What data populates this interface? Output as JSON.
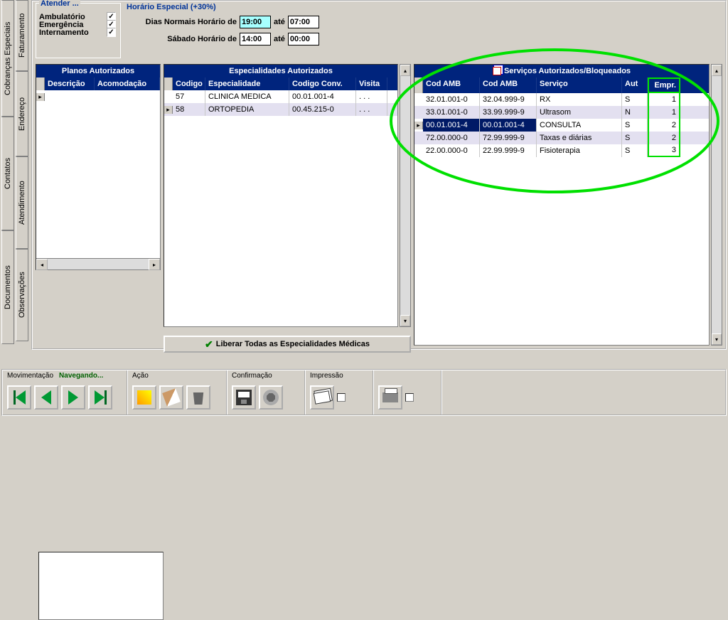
{
  "vtabs": {
    "col1": [
      "Cobranças Especiais",
      "Contatos",
      "Documentos"
    ],
    "col2": [
      "Faturamento",
      "Endereço",
      "Atendimento",
      "Observações"
    ]
  },
  "atender": {
    "title": "Atender ...",
    "items": [
      "Ambulatório",
      "Emergência",
      "Internamento"
    ]
  },
  "horario": {
    "title": "Horário Especial  (+30%)",
    "row1_label": "Dias Normais Horário de",
    "row1_from": "19:00",
    "ate": "até",
    "row1_to": "07:00",
    "row2_label": "Sábado Horário de",
    "row2_from": "14:00",
    "row2_to": "00:00"
  },
  "planos": {
    "title": "Planos Autorizados",
    "headers": [
      "Descrição",
      "Acomodação"
    ]
  },
  "esp": {
    "title": "Especialidades Autorizados",
    "headers": [
      "Codigo",
      "Especialidade",
      "Codigo Conv.",
      "Visita"
    ],
    "rows": [
      {
        "codigo": "57",
        "esp": "CLINICA MEDICA",
        "conv": "00.01.001-4",
        "vis": ". . ."
      },
      {
        "codigo": "58",
        "esp": "ORTOPEDIA",
        "conv": "00.45.215-0",
        "vis": ". . ."
      }
    ],
    "liberar": "Liberar Todas as Especialidades Médicas"
  },
  "serv": {
    "title": "Serviços Autorizados/Bloqueados",
    "headers": [
      "Cod AMB",
      "Cod AMB",
      "Serviço",
      "Aut",
      "Empr."
    ],
    "rows": [
      {
        "c1": "32.01.001-0",
        "c2": "32.04.999-9",
        "svc": "RX",
        "aut": "S",
        "emp": "1"
      },
      {
        "c1": "33.01.001-0",
        "c2": "33.99.999-9",
        "svc": "Ultrasom",
        "aut": "N",
        "emp": "1"
      },
      {
        "c1": "00.01.001-4",
        "c2": "00.01.001-4",
        "svc": "CONSULTA",
        "aut": "S",
        "emp": "2",
        "sel": true
      },
      {
        "c1": "72.00.000-0",
        "c2": "72.99.999-9",
        "svc": "Taxas e diárias",
        "aut": "S",
        "emp": "2"
      },
      {
        "c1": "22.00.000-0",
        "c2": "22.99.999-9",
        "svc": "Fisioterapia",
        "aut": "S",
        "emp": "3"
      }
    ]
  },
  "bottom": {
    "mov": "Movimentação",
    "nav": "Navegando...",
    "acao": "Ação",
    "conf": "Confirmação",
    "imp": "Impressão"
  }
}
